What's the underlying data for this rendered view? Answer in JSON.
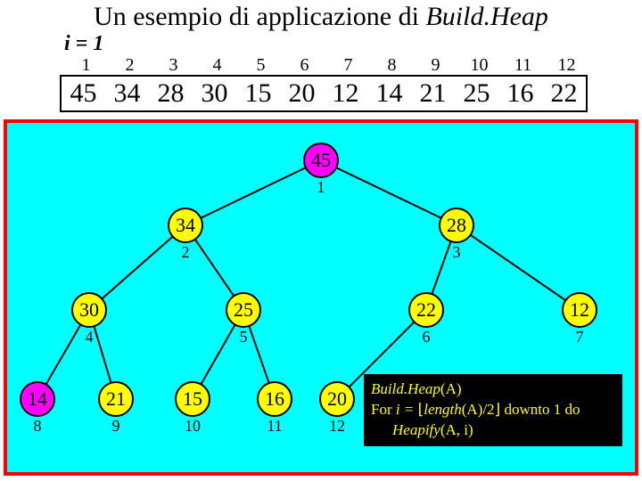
{
  "title_prefix": "Un esempio di applicazione di ",
  "title_func": "Build.Heap",
  "i_label": "i = 1",
  "indices": [
    "1",
    "2",
    "3",
    "4",
    "5",
    "6",
    "7",
    "8",
    "9",
    "10",
    "11",
    "12"
  ],
  "array": [
    "45",
    "34",
    "28",
    "30",
    "15",
    "20",
    "12",
    "14",
    "21",
    "25",
    "16",
    "22"
  ],
  "nodes": {
    "n1": {
      "val": "45",
      "idx": "1"
    },
    "n2": {
      "val": "34",
      "idx": "2"
    },
    "n3": {
      "val": "28",
      "idx": "3"
    },
    "n4": {
      "val": "30",
      "idx": "4"
    },
    "n5": {
      "val": "25",
      "idx": "5"
    },
    "n6": {
      "val": "22",
      "idx": "6"
    },
    "n7": {
      "val": "12",
      "idx": "7"
    },
    "n8": {
      "val": "14",
      "idx": "8"
    },
    "n9": {
      "val": "21",
      "idx": "9"
    },
    "n10": {
      "val": "15",
      "idx": "10"
    },
    "n11": {
      "val": "16",
      "idx": "11"
    },
    "n12": {
      "val": "20",
      "idx": "12"
    }
  },
  "code": {
    "l1a": "Build.Heap",
    "l1b": "(A)",
    "l2a": "For ",
    "l2b": "i = ",
    "l2c": "length",
    "l2d": "(A)/2",
    "l2e": " downto 1 do",
    "l3a": "Heapify",
    "l3b": "(A, i)"
  }
}
